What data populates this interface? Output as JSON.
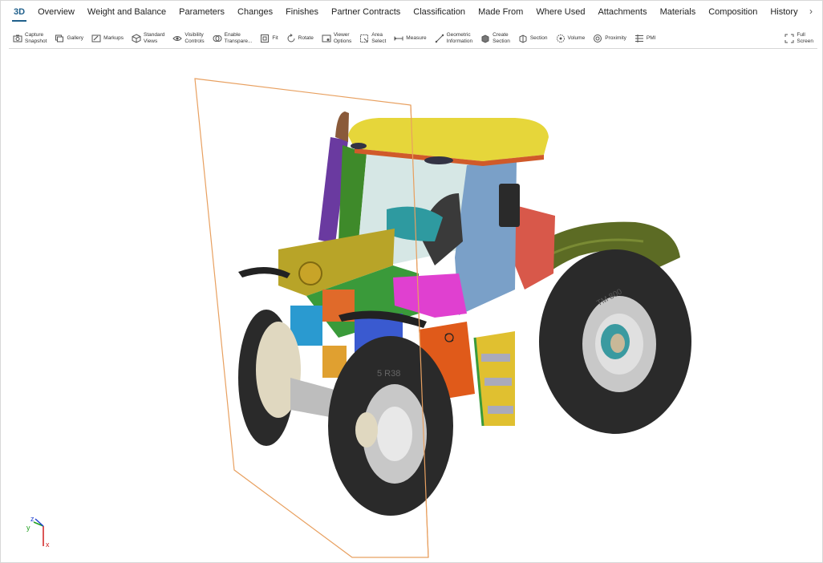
{
  "tabs": [
    {
      "label": "3D",
      "active": true
    },
    {
      "label": "Overview"
    },
    {
      "label": "Weight and Balance"
    },
    {
      "label": "Parameters"
    },
    {
      "label": "Changes"
    },
    {
      "label": "Finishes"
    },
    {
      "label": "Partner Contracts"
    },
    {
      "label": "Classification"
    },
    {
      "label": "Made From"
    },
    {
      "label": "Where Used"
    },
    {
      "label": "Attachments"
    },
    {
      "label": "Materials"
    },
    {
      "label": "Composition"
    },
    {
      "label": "History"
    }
  ],
  "tabs_next_icon": "chevron-right-icon",
  "toolbar": {
    "capture": {
      "l1": "Capture",
      "l2": "Snapshot",
      "icon": "camera-icon"
    },
    "gallery": {
      "l1": "Gallery",
      "icon": "gallery-icon"
    },
    "markups": {
      "l1": "Markups",
      "icon": "markup-icon"
    },
    "standard_views": {
      "l1": "Standard",
      "l2": "Views",
      "icon": "cube-icon"
    },
    "visibility": {
      "l1": "Visibility",
      "l2": "Controls",
      "icon": "eye-icon"
    },
    "transparency": {
      "l1": "Enable",
      "l2": "Transpare...",
      "icon": "transparency-icon"
    },
    "fit": {
      "l1": "Fit",
      "icon": "fit-icon"
    },
    "rotate": {
      "l1": "Rotate",
      "icon": "rotate-icon"
    },
    "viewer_options": {
      "l1": "Viewer",
      "l2": "Options",
      "icon": "viewer-options-icon"
    },
    "area_select": {
      "l1": "Area",
      "l2": "Select",
      "icon": "area-select-icon"
    },
    "measure": {
      "l1": "Measure",
      "icon": "measure-icon"
    },
    "geometric": {
      "l1": "Geometric",
      "l2": "Information",
      "icon": "geometry-icon"
    },
    "create_section": {
      "l1": "Create",
      "l2": "Section",
      "icon": "create-section-icon"
    },
    "section": {
      "l1": "Section",
      "icon": "section-icon"
    },
    "volume": {
      "l1": "Volume",
      "icon": "volume-icon"
    },
    "proximity": {
      "l1": "Proximity",
      "icon": "proximity-icon"
    },
    "pmi": {
      "l1": "PMI",
      "icon": "pmi-icon"
    },
    "full_screen": {
      "l1": "Full",
      "l2": "Screen",
      "icon": "full-screen-icon"
    }
  },
  "model": {
    "tire_text_rear": "TM 800",
    "tire_text_front": "5 R38"
  },
  "triad": {
    "z": "z",
    "y": "y",
    "x": "x"
  },
  "colors": {
    "accent": "#1f5f8b",
    "section_plane": "#e8a060",
    "cab_roof": "#e6d63a",
    "body_olive": "#5c6b24",
    "tire": "#2a2a2a",
    "wheel_rim": "#c8c8c8"
  }
}
